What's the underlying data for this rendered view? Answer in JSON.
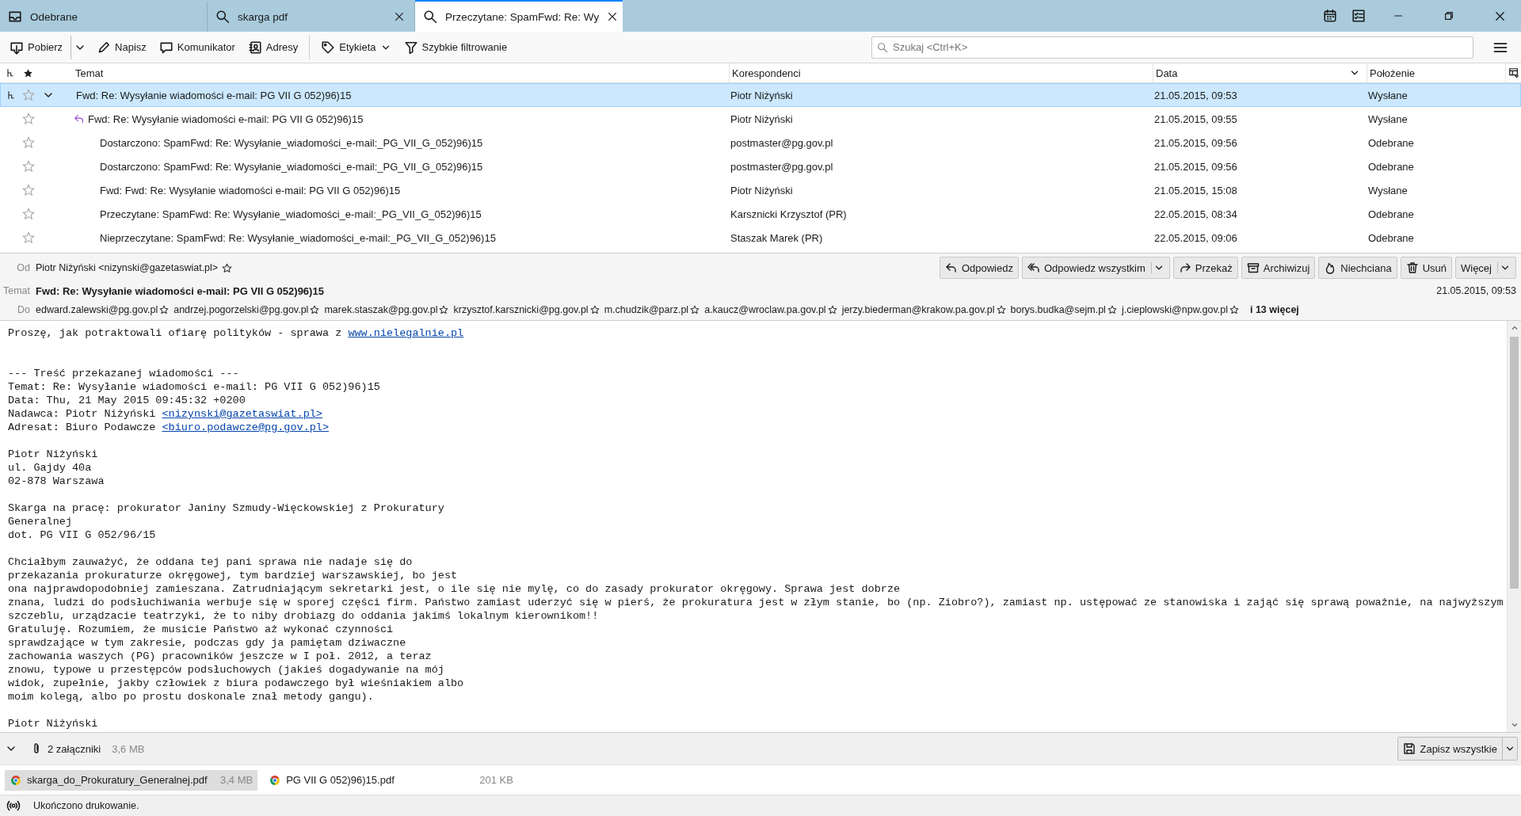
{
  "tabs": [
    {
      "label": "Odebrane",
      "closable": false,
      "selected": false
    },
    {
      "label": "skarga pdf",
      "closable": true,
      "selected": false
    },
    {
      "label": "Przeczytane: SpamFwd: Re: Wy",
      "closable": true,
      "selected": true
    }
  ],
  "toolbar": {
    "buttons": [
      {
        "label": "Pobierz",
        "kind": "split"
      },
      {
        "label": "Napisz",
        "kind": "plain"
      },
      {
        "label": "Komunikator",
        "kind": "plain"
      },
      {
        "label": "Adresy",
        "kind": "plain"
      },
      {
        "label": "Etykieta",
        "kind": "menu"
      },
      {
        "label": "Szybkie filtrowanie",
        "kind": "plain"
      }
    ],
    "search": {
      "placeholder": "Szukaj <Ctrl+K>"
    }
  },
  "thread_list": {
    "columns": [
      "Temat",
      "Korespondenci",
      "Data",
      "Położenie"
    ],
    "rows": [
      {
        "subject": "Fwd: Re: Wysyłanie wiadomości e-mail: PG VII G 052)96)15",
        "correspondent": "Piotr Niżyński",
        "date": "21.05.2015, 09:53",
        "location": "Wysłane",
        "selected": true,
        "starred": false,
        "replied": false,
        "expanded": true,
        "children": [
          {
            "subject": "Fwd: Re: Wysyłanie wiadomości e-mail: PG VII G 052)96)15",
            "correspondent": "Piotr Niżyński",
            "date": "21.05.2015, 09:55",
            "location": "Wysłane",
            "selected": false,
            "starred": false,
            "replied": true,
            "children": [
              {
                "subject": "Dostarczono: SpamFwd: Re: Wysyłanie_wiadomości_e-mail:_PG_VII_G_052)96)15",
                "correspondent": "postmaster@pg.gov.pl",
                "date": "21.05.2015, 09:56",
                "location": "Odebrane",
                "selected": false,
                "starred": false,
                "replied": false
              },
              {
                "subject": "Dostarczono: SpamFwd: Re: Wysyłanie_wiadomości_e-mail:_PG_VII_G_052)96)15",
                "correspondent": "postmaster@pg.gov.pl",
                "date": "21.05.2015, 09:56",
                "location": "Odebrane",
                "selected": false,
                "starred": false,
                "replied": false
              },
              {
                "subject": "Fwd: Fwd: Re: Wysyłanie wiadomości e-mail: PG VII G 052)96)15",
                "correspondent": "Piotr Niżyński",
                "date": "21.05.2015, 15:08",
                "location": "Wysłane",
                "selected": false,
                "starred": false,
                "replied": false
              },
              {
                "subject": "Przeczytane: SpamFwd: Re: Wysyłanie_wiadomości_e-mail:_PG_VII_G_052)96)15",
                "correspondent": "Karsznicki Krzysztof (PR)",
                "date": "22.05.2015, 08:34",
                "location": "Odebrane",
                "selected": false,
                "starred": false,
                "replied": false
              },
              {
                "subject": "Nieprzeczytane: SpamFwd: Re: Wysyłanie_wiadomości_e-mail:_PG_VII_G_052)96)15",
                "correspondent": "Staszak Marek (PR)",
                "date": "22.05.2015, 09:06",
                "location": "Odebrane",
                "selected": false,
                "starred": false,
                "replied": false
              }
            ]
          }
        ]
      }
    ]
  },
  "message_header": {
    "from_label": "Od",
    "from": "Piotr Niżyński <nizynski@gazetaswiat.pl>",
    "actions": [
      {
        "label": "Odpowiedz",
        "dropdown": false
      },
      {
        "label": "Odpowiedz wszystkim",
        "dropdown": true
      },
      {
        "label": "Przekaż",
        "dropdown": false
      },
      {
        "label": "Archiwizuj",
        "dropdown": false
      },
      {
        "label": "Niechciana",
        "dropdown": false
      },
      {
        "label": "Usuń",
        "dropdown": false
      },
      {
        "label": "Więcej",
        "dropdown": true
      }
    ],
    "subject_label": "Temat",
    "subject": "Fwd: Re: Wysyłanie wiadomości e-mail: PG VII G 052)96)15",
    "date": "21.05.2015, 09:53",
    "to_label": "Do",
    "recipients": [
      "edward.zalewski@pg.gov.pl",
      "andrzej.pogorzelski@pg.gov.pl",
      "marek.staszak@pg.gov.pl",
      "krzysztof.karsznicki@pg.gov.pl",
      "m.chudzik@parz.pl",
      "a.kaucz@wroclaw.pa.gov.pl",
      "jerzy.biederman@krakow.pa.gov.pl",
      "borys.budka@sejm.pl",
      "j.cieplowski@npw.gov.pl"
    ],
    "more_recipients": "i 13 więcej"
  },
  "message_body": {
    "paragraphs": [
      {
        "lines": [
          {
            "text": "Proszę, jak potraktowali ofiarę polityków - sprawa z ",
            "link": "www.nielegalnie.pl"
          }
        ]
      },
      {
        "lines": [
          {
            "text": "--- Treść przekazanej wiadomości ---"
          },
          {
            "text": "Temat: Re: Wysyłanie wiadomości e-mail: PG VII G 052)96)15"
          },
          {
            "text": "Data: Thu, 21 May 2015 09:45:32 +0200"
          },
          {
            "text": "Nadawca: Piotr Niżyński ",
            "link": "<nizynski@gazetaswiat.pl>"
          },
          {
            "text": "Adresat: Biuro Podawcze ",
            "link": "<biuro.podawcze@pg.gov.pl>"
          }
        ]
      },
      {
        "lines": [
          {
            "text": "Piotr Niżyński"
          },
          {
            "text": "ul. Gajdy 40a"
          },
          {
            "text": "02-878 Warszawa"
          }
        ]
      },
      {
        "lines": [
          {
            "text": "Skarga na pracę: prokurator Janiny Szmudy-Więckowskiej z Prokuratury"
          },
          {
            "text": "Generalnej"
          },
          {
            "text": "dot. PG VII G 052/96/15"
          }
        ]
      },
      {
        "lines": [
          {
            "text": "Chciałbym zauważyć, że oddana tej pani sprawa nie nadaje się do"
          },
          {
            "text": "przekazania prokuraturze okręgowej, tym bardziej warszawskiej, bo jest"
          },
          {
            "text": "ona najprawdopodobniej zamieszana. Zatrudniającym sekretarki jest, o ile się nie mylę, co do zasady prokurator okręgowy. Sprawa jest dobrze"
          },
          {
            "text": "znana, ludzi do podsłuchiwania werbuje się w sporej części firm. Państwo zamiast uderzyć się w pierś, że prokuratura jest w złym stanie, bo (np. Ziobro?), zamiast np. ustępować ze stanowiska i zająć się sprawą poważnie, na najwyższym"
          },
          {
            "text": "szczeblu, urządzacie teatrzyki, że to niby drobiazg do oddania jakimś lokalnym kierownikom!!"
          },
          {
            "text": "Gratuluję. Rozumiem, że musicie Państwo aż wykonać czynności"
          },
          {
            "text": "sprawdzające w tym zakresie, podczas gdy ja pamiętam dziwaczne"
          },
          {
            "text": "zachowania waszych (PG) pracowników jeszcze w I poł. 2012, a teraz"
          },
          {
            "text": "znowu, typowe u przestępców podsłuchowych (jakieś dogadywanie na mój"
          },
          {
            "text": "widok, zupełnie, jakby człowiek z biura podawczego był wieśniakiem albo"
          },
          {
            "text": "moim kolegą, albo po prostu doskonale znał metody gangu)."
          }
        ]
      },
      {
        "lines": [
          {
            "text": "Piotr Niżyński"
          }
        ]
      }
    ]
  },
  "attachments": {
    "expanded": true,
    "count": "2 załączniki",
    "total_size": "3,6 MB",
    "save_all": "Zapisz wszystkie",
    "files": [
      {
        "name": "skarga_do_Prokuratury_Generalnej.pdf",
        "size": "3,4 MB",
        "selected": true
      },
      {
        "name": "PG VII G 052)96)15.pdf",
        "size": "201 KB",
        "selected": false
      }
    ]
  },
  "status_bar": {
    "text": "Ukończono drukowanie."
  }
}
